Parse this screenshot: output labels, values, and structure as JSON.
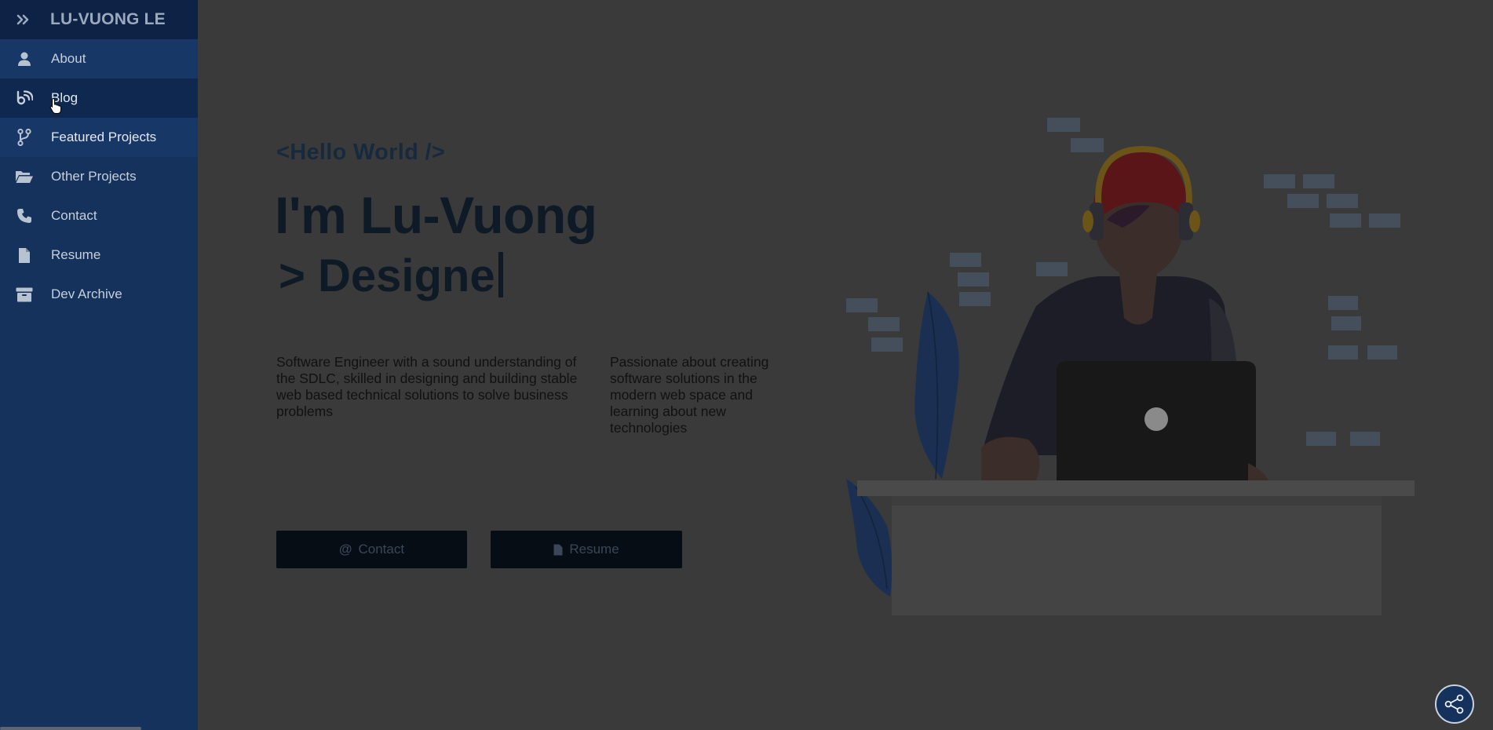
{
  "sidebar": {
    "brand": "LU-VUONG LE",
    "items": [
      {
        "label": "About",
        "icon": "user-icon"
      },
      {
        "label": "Blog",
        "icon": "blog-icon"
      },
      {
        "label": "Featured Projects",
        "icon": "code-branch-icon"
      },
      {
        "label": "Other Projects",
        "icon": "folder-open-icon"
      },
      {
        "label": "Contact",
        "icon": "phone-icon"
      },
      {
        "label": "Resume",
        "icon": "file-icon"
      },
      {
        "label": "Dev Archive",
        "icon": "archive-icon"
      }
    ]
  },
  "hero": {
    "greeting": "<Hello World />",
    "headline": "I'm Lu-Vuong",
    "typed_text": "> Designe",
    "description_left": "Software Engineer with a sound understanding of the SDLC, skilled in designing and building stable web based technical solutions to solve business problems",
    "description_right": "Passionate about creating software solutions in the modern web space and learning about new technologies",
    "buttons": {
      "contact": "Contact",
      "resume": "Resume"
    }
  },
  "colors": {
    "sidebar": "#15325d",
    "sidebar_header": "#0d2244",
    "overlay_background": "#3a3a3a",
    "button": "#060d15"
  }
}
